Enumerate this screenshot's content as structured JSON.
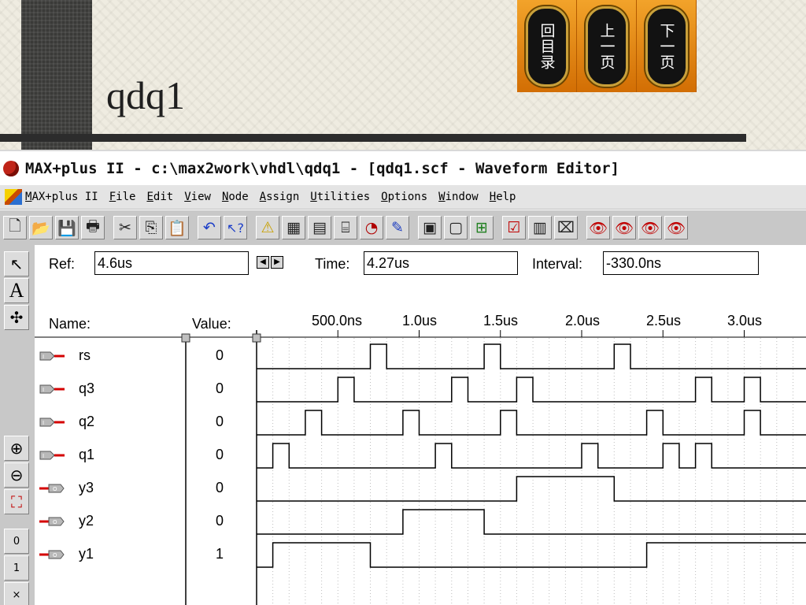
{
  "slide": {
    "title": "qdq1",
    "nav": [
      {
        "label": "回目录"
      },
      {
        "label": "上一页"
      },
      {
        "label": "下一页"
      }
    ]
  },
  "window": {
    "title": "MAX+plus II - c:\\max2work\\vhdl\\qdq1 - [qdq1.scf - Waveform Editor]"
  },
  "menu": {
    "items": [
      "MAX+plus II",
      "File",
      "Edit",
      "View",
      "Node",
      "Assign",
      "Utilities",
      "Options",
      "Window",
      "Help"
    ]
  },
  "toolbar": {
    "icons": [
      "new-file-icon",
      "open-folder-icon",
      "save-icon",
      "print-icon",
      "cut-icon",
      "copy-icon",
      "paste-icon",
      "undo-icon",
      "help-pointer-icon",
      "hierarchy-warning-icon",
      "floorplan-icon",
      "compiler-icon",
      "simulator-icon",
      "timing-analyzer-icon",
      "programmer-icon",
      "project-hierarchy-icon",
      "project-set-icon",
      "project-save-compile-icon",
      "project-save-check-icon",
      "project-save-icon",
      "simulate-icon",
      "eye-a-icon",
      "eye-ba-icon",
      "eye-signal-icon",
      "eye-bus-icon"
    ]
  },
  "palette": {
    "tools": [
      "pointer-tool-icon",
      "text-tool-icon",
      "node-tool-icon",
      "zoom-in-icon",
      "zoom-out-icon",
      "fit-window-icon",
      "level-0-icon",
      "level-1-icon",
      "level-x-icon"
    ]
  },
  "editor": {
    "ref_label": "Ref:",
    "ref_value": "4.6us",
    "time_label": "Time:",
    "time_value": "4.27us",
    "interval_label": "Interval:",
    "interval_value": "-330.0ns",
    "name_header": "Name:",
    "value_header": "Value:",
    "time_ticks": [
      "500.0ns",
      "1.0us",
      "1.5us",
      "2.0us",
      "2.5us",
      "3.0us"
    ]
  },
  "signals": [
    {
      "name": "rs",
      "direction": "input",
      "value": "0",
      "highs": [
        [
          0.7,
          0.8
        ],
        [
          1.4,
          1.5
        ],
        [
          2.2,
          2.3
        ]
      ]
    },
    {
      "name": "q3",
      "direction": "input",
      "value": "0",
      "highs": [
        [
          0.5,
          0.6
        ],
        [
          1.2,
          1.3
        ],
        [
          1.6,
          1.7
        ],
        [
          2.7,
          2.8
        ],
        [
          3.0,
          3.1
        ]
      ]
    },
    {
      "name": "q2",
      "direction": "input",
      "value": "0",
      "highs": [
        [
          0.3,
          0.4
        ],
        [
          0.9,
          1.0
        ],
        [
          1.5,
          1.6
        ],
        [
          2.4,
          2.5
        ],
        [
          3.0,
          3.1
        ]
      ]
    },
    {
      "name": "q1",
      "direction": "input",
      "value": "0",
      "highs": [
        [
          0.1,
          0.2
        ],
        [
          1.1,
          1.2
        ],
        [
          2.0,
          2.1
        ],
        [
          2.5,
          2.6
        ],
        [
          2.7,
          2.8
        ]
      ]
    },
    {
      "name": "y3",
      "direction": "output",
      "value": "0",
      "highs": [
        [
          1.6,
          2.2
        ]
      ]
    },
    {
      "name": "y2",
      "direction": "output",
      "value": "0",
      "highs": [
        [
          0.9,
          1.4
        ]
      ]
    },
    {
      "name": "y1",
      "direction": "output",
      "value": "1",
      "highs": [
        [
          0.1,
          0.7
        ],
        [
          2.4,
          3.4
        ]
      ]
    }
  ],
  "colors": {
    "nav_orange": "#e88a0a",
    "signal_red": "#d40000",
    "wave": "#000000",
    "grid_dots": "#bdbdbd"
  }
}
